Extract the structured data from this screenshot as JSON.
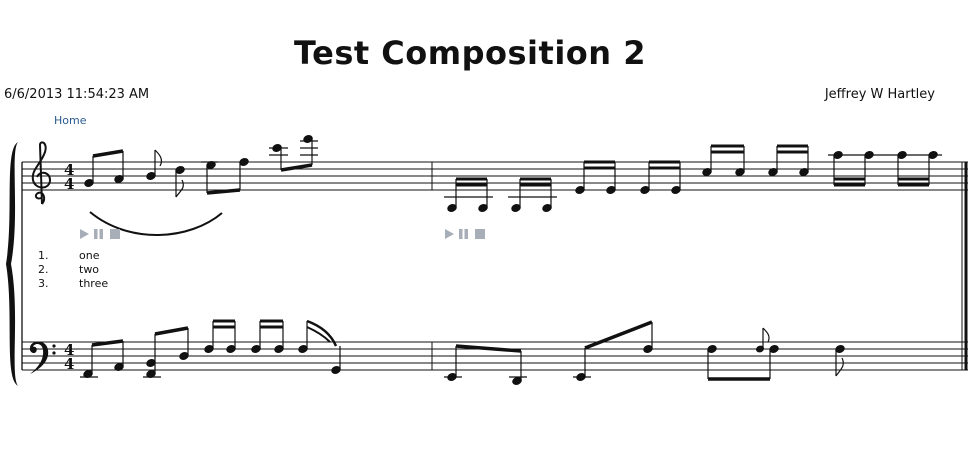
{
  "header": {
    "title": "Test Composition 2",
    "date": "6/6/2013 11:54:23 AM",
    "author": "Jeffrey W Hartley",
    "home_link": "Home"
  },
  "score": {
    "time_signature": {
      "top": "4",
      "bottom": "4"
    },
    "measures": 2,
    "clefs": [
      "treble-clef",
      "bass-clef"
    ]
  },
  "lyrics": [
    {
      "number": "1.",
      "text": "one"
    },
    {
      "number": "2.",
      "text": "two"
    },
    {
      "number": "3.",
      "text": "three"
    }
  ],
  "player_controls": [
    "play-icon",
    "pause-icon",
    "stop-icon"
  ],
  "colors": {
    "text": "#111111",
    "link": "#2b5a8f",
    "controls": "#a8aeb8"
  }
}
